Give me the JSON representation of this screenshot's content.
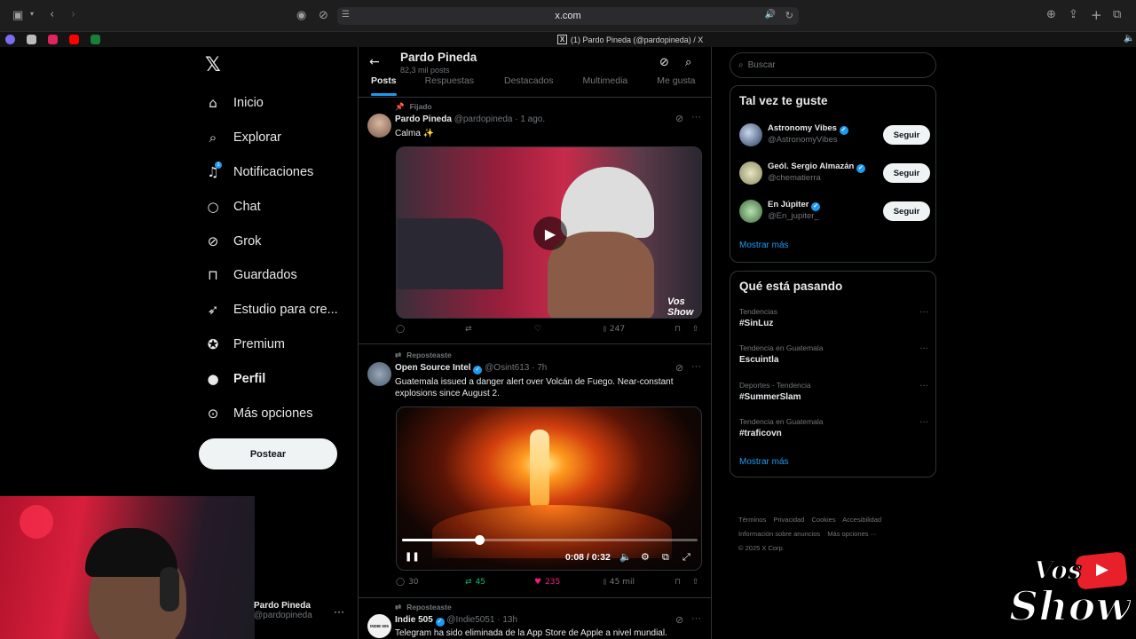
{
  "browser": {
    "url": "x.com",
    "tab_title": "(1) Pardo Pineda (@pardopineda) / X",
    "tab_favicon_letter": "X"
  },
  "nav": {
    "items": [
      {
        "label": "Inicio",
        "icon": "home-icon"
      },
      {
        "label": "Explorar",
        "icon": "search-icon"
      },
      {
        "label": "Notificaciones",
        "icon": "bell-icon",
        "badge": "1"
      },
      {
        "label": "Chat",
        "icon": "chat-bubble-icon"
      },
      {
        "label": "Grok",
        "icon": "grok-icon"
      },
      {
        "label": "Guardados",
        "icon": "bookmark-icon"
      },
      {
        "label": "Estudio para cre...",
        "icon": "rocket-icon"
      },
      {
        "label": "Premium",
        "icon": "premium-check-icon"
      },
      {
        "label": "Perfil",
        "icon": "person-icon"
      },
      {
        "label": "Más opciones",
        "icon": "more-circle-icon"
      }
    ],
    "post_button": "Postear",
    "account_name": "Pardo Pineda",
    "account_handle": "@pardopineda"
  },
  "profile": {
    "name": "Pardo Pineda",
    "posts_count": "82,3 mil posts",
    "tabs": [
      "Posts",
      "Respuestas",
      "Destacados",
      "Multimedia",
      "Me gusta"
    ],
    "active_tab": "Posts"
  },
  "posts": [
    {
      "context": "Fijado",
      "name": "Pardo Pineda",
      "handle": "@pardopineda",
      "time": "· 1 ago.",
      "text": "Calma ✨",
      "views": "247",
      "replies": "",
      "reposts": "",
      "likes": "",
      "watermark": "Vos Show"
    },
    {
      "context": "Reposteaste",
      "name": "Open Source Intel",
      "handle": "@Osint613",
      "time": "· 7h",
      "text": "Guatemala issued a danger alert over Volcán de Fuego. Near-constant explosions since August 2.",
      "video_time": "0:08 / 0:32",
      "video_progress": 0.26,
      "replies": "30",
      "reposts": "45",
      "likes": "235",
      "views": "45 mil"
    },
    {
      "context": "Reposteaste",
      "name": "Indie 505",
      "handle": "@Indie5051",
      "time": "· 13h",
      "text": "Telegram ha sido eliminada de la App Store de Apple a nivel mundial.",
      "avatar_text": "INDIE 505"
    }
  ],
  "sidebar": {
    "search_placeholder": "Buscar",
    "suggestions_title": "Tal vez te guste",
    "suggestions": [
      {
        "name": "Astronomy Vibes",
        "handle": "@AstronomyVibes",
        "button": "Seguir"
      },
      {
        "name": "Geól. Sergio Almazán",
        "handle": "@chematierra",
        "button": "Seguir"
      },
      {
        "name": "En Júpiter",
        "handle": "@En_jupiter_",
        "button": "Seguir"
      }
    ],
    "show_more": "Mostrar más",
    "trends_title": "Qué está pasando",
    "trends": [
      {
        "context": "Tendencias",
        "name": "#SinLuz"
      },
      {
        "context": "Tendencia en Guatemala",
        "name": "Escuintla"
      },
      {
        "context": "Deportes · Tendencia",
        "name": "#SummerSlam"
      },
      {
        "context": "Tendencia en Guatemala",
        "name": "#traficovn"
      }
    ],
    "trends_more": "Mostrar más",
    "footer": [
      "Términos",
      "Privacidad",
      "Cookies",
      "Accesibilidad",
      "Información sobre anuncios",
      "Más opciones ···",
      "© 2025 X Corp."
    ]
  },
  "overlay": {
    "logo_text_1": "Vos",
    "logo_text_2": "Show"
  },
  "colors": {
    "accent": "#1d9bf0",
    "repost_green": "#00ba7c",
    "like_pink": "#f91880",
    "border": "#2f3336"
  }
}
